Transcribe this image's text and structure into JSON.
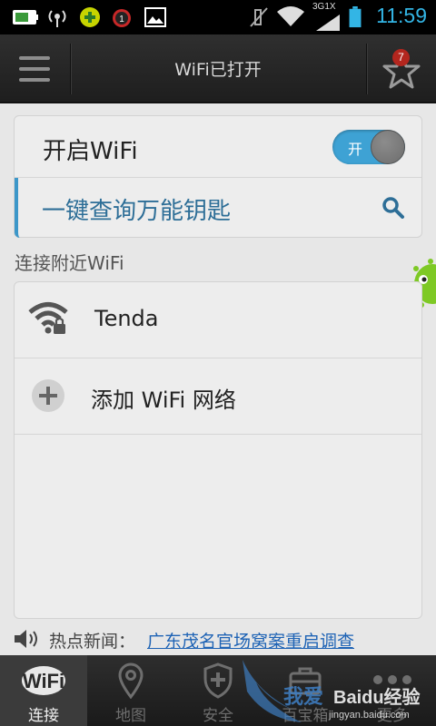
{
  "status_bar": {
    "network": "3G1X",
    "time": "11:59",
    "notification_count": "1"
  },
  "header": {
    "title": "WiFi已打开",
    "favorites_badge": "7"
  },
  "wifi_toggle": {
    "label": "开启WiFi",
    "state_text": "开",
    "on": true
  },
  "key_query": {
    "label": "一键查询万能钥匙"
  },
  "nearby": {
    "section_title": "连接附近WiFi",
    "networks": [
      {
        "name": "Tenda",
        "secured": true
      }
    ],
    "add_network_label": "添加 WiFi 网络"
  },
  "news": {
    "label": "热点新闻：",
    "headline": "广东茂名官场窝案重启调查"
  },
  "bottom_nav": {
    "items": [
      {
        "label": "连接",
        "active": true
      },
      {
        "label": "地图",
        "active": false
      },
      {
        "label": "安全",
        "active": false
      },
      {
        "label": "百宝箱",
        "active": false
      },
      {
        "label": "更多",
        "active": false
      }
    ]
  },
  "watermark": {
    "text": "我爱",
    "brand": "Baidu经验",
    "url": "jingyan.baidu.com"
  },
  "colors": {
    "accent": "#3ea2d4",
    "time": "#33b5e5",
    "badge": "#b3261e",
    "link": "#1e63b5"
  }
}
